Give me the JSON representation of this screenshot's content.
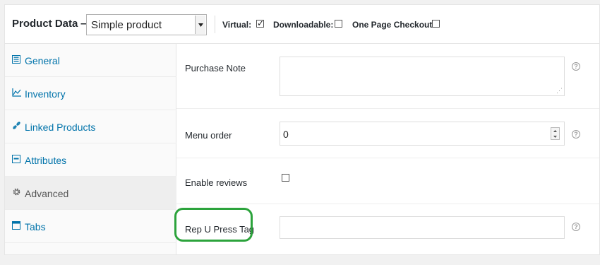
{
  "header": {
    "title": "Product Data —",
    "product_type": "Simple product",
    "options": [
      {
        "label": "Virtual:",
        "checked": true
      },
      {
        "label": "Downloadable:",
        "checked": false
      },
      {
        "label": "One Page Checkout:",
        "checked": false
      }
    ]
  },
  "sidebar": {
    "tabs": [
      {
        "label": "General",
        "icon": "general-icon"
      },
      {
        "label": "Inventory",
        "icon": "inventory-icon"
      },
      {
        "label": "Linked Products",
        "icon": "link-icon"
      },
      {
        "label": "Attributes",
        "icon": "attributes-icon"
      },
      {
        "label": "Advanced",
        "icon": "gear-icon",
        "active": true
      },
      {
        "label": "Tabs",
        "icon": "tabs-icon"
      }
    ]
  },
  "fields": {
    "purchase_note": {
      "label": "Purchase Note",
      "value": ""
    },
    "menu_order": {
      "label": "Menu order",
      "value": "0"
    },
    "enable_reviews": {
      "label": "Enable reviews",
      "checked": false
    },
    "rep_u_press_tag": {
      "label": "Rep U Press Tag",
      "value": ""
    }
  },
  "help_glyph": "?",
  "colors": {
    "link": "#0073aa",
    "highlight": "#2ca33c"
  }
}
